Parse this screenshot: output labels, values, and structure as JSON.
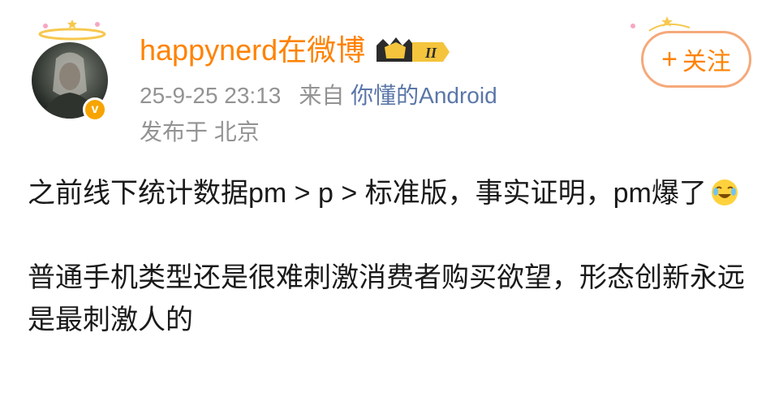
{
  "post": {
    "author": {
      "name": "happynerd在微博",
      "avatar_icon": "portrait-avatar",
      "verified_icon": "verified-v-badge",
      "verified_mark": "v",
      "level_badge_icon": "crown-level-badge",
      "level_badge_text": "II"
    },
    "time": "25-9-25 23:13",
    "source_prefix": "来自",
    "source_name": "你懂的Android",
    "location": "发布于 北京",
    "follow_plus": "+",
    "follow_label": "关注",
    "paragraphs": [
      "之前线下统计数据pm > p > 标准版，事实证明，pm爆了",
      "普通手机类型还是很难刺激消费者购买欲望，形态创新永远是最刺激人的"
    ],
    "emoji_icon": "crying-laughing-emoji"
  },
  "colors": {
    "username": "#ff8200",
    "meta": "#939393",
    "link": "#5a76a8",
    "body_text": "#1a1a1a",
    "follow_border": "#f5a97a",
    "badge_gold": "#f7a400"
  }
}
